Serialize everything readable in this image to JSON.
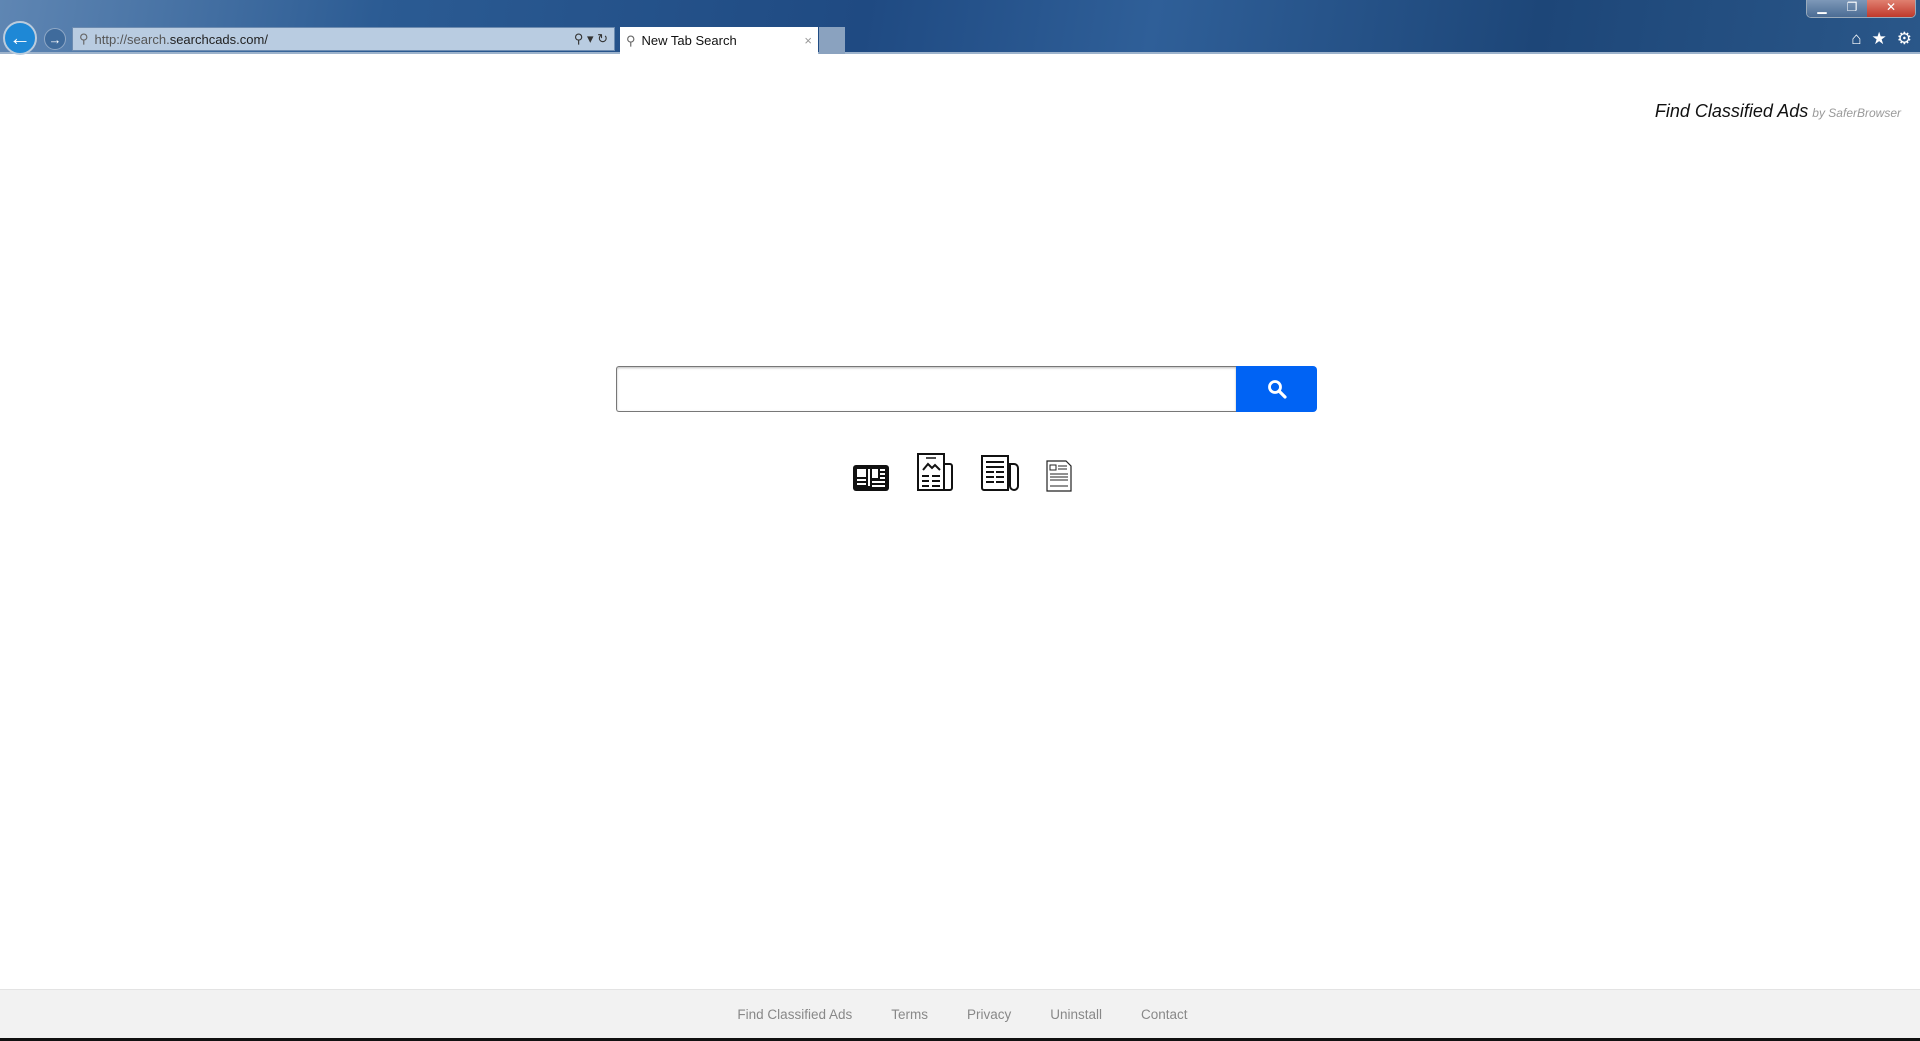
{
  "browser": {
    "url_prefix": "http://search.",
    "url_domain": "searchcads.com/",
    "tab_title": "New Tab Search",
    "tab_close": "×",
    "window_buttons": {
      "minimize": "▁",
      "restore": "❐",
      "close": "✕"
    },
    "tools": {
      "home": "⌂",
      "favorites": "★",
      "settings": "⚙"
    }
  },
  "page": {
    "brand_title": "Find Classified Ads",
    "brand_by": "by SaferBrowser",
    "search_placeholder": "",
    "search_value": "",
    "accent_color": "#0063f4",
    "shortcut_icons": [
      "newspaper-icon",
      "news-article-image-icon",
      "folded-newspaper-icon",
      "document-icon"
    ]
  },
  "footer": {
    "links": [
      "Find Classified Ads",
      "Terms",
      "Privacy",
      "Uninstall",
      "Contact"
    ]
  }
}
